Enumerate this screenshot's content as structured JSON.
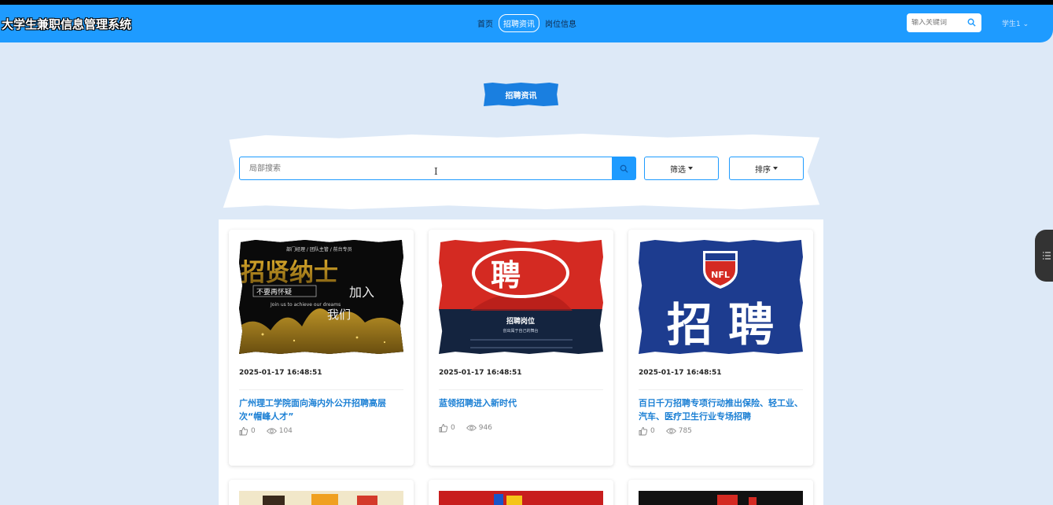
{
  "header": {
    "site_title": "大学生兼职信息管理系统",
    "nav": [
      {
        "label": "首页",
        "active": false
      },
      {
        "label": "招聘资讯",
        "active": true
      },
      {
        "label": "岗位信息",
        "active": false
      }
    ],
    "search_placeholder": "输入关键词",
    "user_label": "学生1"
  },
  "section": {
    "title": "招聘资讯"
  },
  "filters": {
    "search_placeholder": "局部搜索",
    "filter_label": "筛选",
    "sort_label": "排序"
  },
  "cards": [
    {
      "date": "2025-01-17 16:48:51",
      "title": "广州理工学院面向海内外公开招聘高层次“帽峰人才”",
      "likes": "0",
      "views": "104",
      "image_text": {
        "tagline": "部门经理 / 团队主管 / 前台专员",
        "big": "招贤纳士",
        "sub": "不要再怀疑",
        "join": "加入",
        "us": "我们",
        "english": "Join us to achieve our dreams"
      }
    },
    {
      "date": "2025-01-17 16:48:51",
      "title": "蓝领招聘进入新时代",
      "likes": "0",
      "views": "946",
      "image_text": {
        "big": "聘",
        "sub": "招聘岗位",
        "sub2": "创出属于自己的舞台"
      }
    },
    {
      "date": "2025-01-17 16:48:51",
      "title": "百日千万招聘专项行动推出保险、轻工业、汽车、医疗卫生行业专场招聘",
      "likes": "0",
      "views": "785",
      "image_text": {
        "logo": "NFL",
        "big": "招 聘"
      }
    }
  ],
  "icons": {
    "header_search": "search-icon",
    "local_search": "search-icon",
    "like": "thumbs-up-icon",
    "view": "eye-icon",
    "side_tab": "list-icon",
    "user_caret": "chevron-down-icon"
  },
  "colors": {
    "navbar": "#1e9bff",
    "accent": "#1a7fe0",
    "page_bg": "#dde9f7",
    "card_title": "#1a7fd4"
  }
}
